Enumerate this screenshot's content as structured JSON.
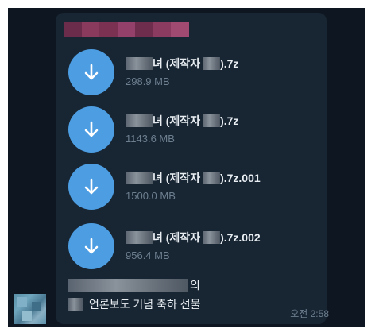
{
  "files": [
    {
      "name_suffix": "녀 (제작자",
      "ext": ").7z",
      "size": "298.9 MB"
    },
    {
      "name_suffix": "녀 (제작자",
      "ext": ").7z",
      "size": "1143.6 MB"
    },
    {
      "name_suffix": "녀 (제작자",
      "ext": ").7z.001",
      "size": "1500.0 MB"
    },
    {
      "name_suffix": "녀 (제작자",
      "ext": ").7z.002",
      "size": "956.4 MB"
    }
  ],
  "caption": {
    "line1_suffix": "의",
    "line2_text": "언론보도 기념 축하 선물"
  },
  "time": "오전 2:58",
  "icons": {
    "download": "download-arrow-icon"
  },
  "colors": {
    "chat_bg": "#0e1621",
    "bubble": "#182533",
    "accent": "#4c9de2",
    "text": "#e9eef3",
    "muted": "#6d7f8f"
  }
}
